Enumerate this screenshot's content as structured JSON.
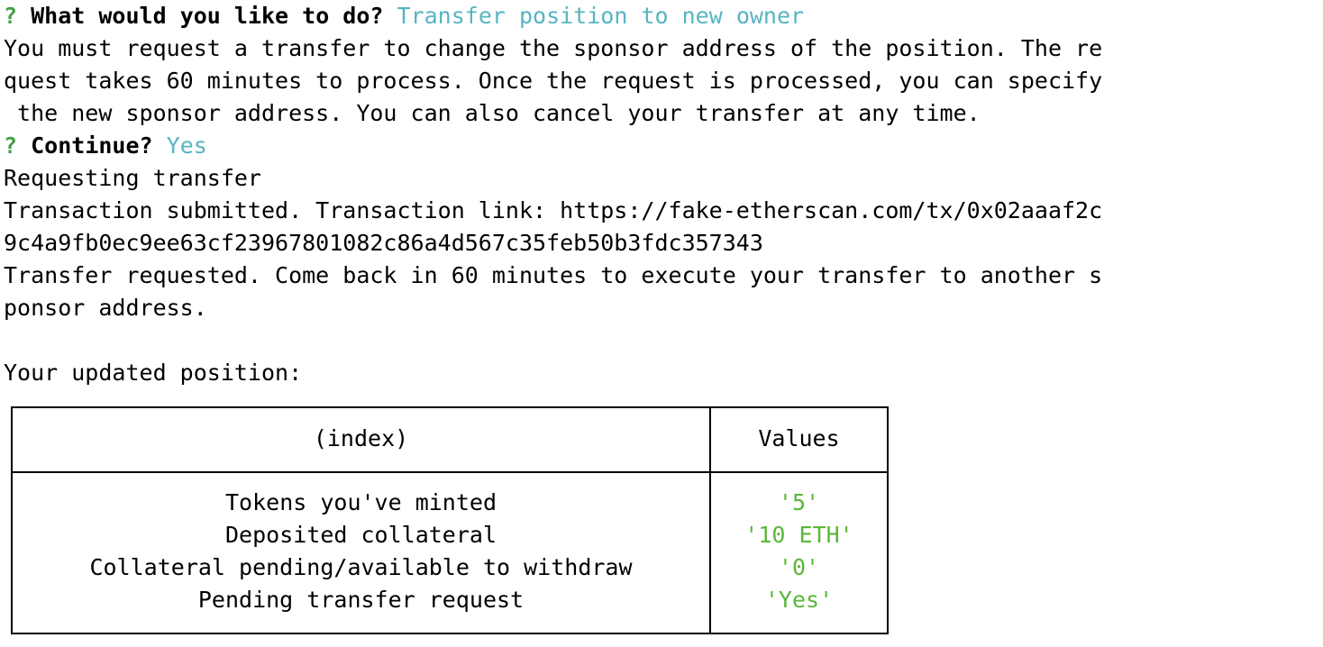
{
  "terminal": {
    "prompt1": {
      "marker": "?",
      "question": "What would you like to do?",
      "answer": "Transfer position to new owner"
    },
    "info_lines": [
      "You must request a transfer to change the sponsor address of the position. The re",
      "quest takes 60 minutes to process. Once the request is processed, you can specify",
      " the new sponsor address. You can also cancel your transfer at any time."
    ],
    "prompt2": {
      "marker": "?",
      "question": "Continue?",
      "answer": "Yes"
    },
    "status_lines": [
      "Requesting transfer",
      "Transaction submitted. Transaction link: https://fake-etherscan.com/tx/0x02aaaf2c",
      "9c4a9fb0ec9ee63cf23967801082c86a4d567c35feb50b3fdc357343",
      "Transfer requested. Come back in 60 minutes to execute your transfer to another s",
      "ponsor address."
    ],
    "updated_heading": "Your updated position:"
  },
  "table": {
    "headers": [
      "(index)",
      "Values"
    ],
    "rows": [
      {
        "index": "Tokens you've minted",
        "value": "'5'"
      },
      {
        "index": "Deposited collateral",
        "value": "'10 ETH'"
      },
      {
        "index": "Collateral pending/available to withdraw",
        "value": "'0'"
      },
      {
        "index": "Pending transfer request",
        "value": "'Yes'"
      }
    ]
  },
  "colors": {
    "prompt_marker": "#43a047",
    "answer": "#57b5c2",
    "table_value": "#5bb738"
  }
}
